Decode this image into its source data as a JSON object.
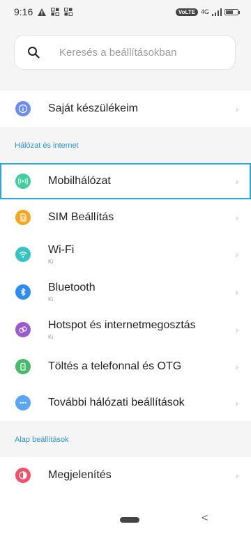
{
  "status_bar": {
    "time": "9:16",
    "left_icons": [
      "alert-icon",
      "sim-data-icon",
      "sim-data-icon"
    ],
    "volte": "VoLTE",
    "network": "4G",
    "battery_level": 0.6
  },
  "search": {
    "placeholder": "Keresés a beállításokban",
    "value": ""
  },
  "top_item": {
    "label": "Saját készülékeim",
    "icon": "info-icon",
    "color": "#6b8cf0"
  },
  "sections": [
    {
      "title": "Hálózat és internet",
      "items": [
        {
          "label": "Mobilhálózat",
          "sub": "",
          "icon": "antenna-icon",
          "color": "#3fcf9a",
          "selected": true
        },
        {
          "label": "SIM Beállítás",
          "sub": "",
          "icon": "sim-card-icon",
          "color": "#f5a623"
        },
        {
          "label": "Wi-Fi",
          "sub": "Ki",
          "icon": "wifi-icon",
          "color": "#37c4c0"
        },
        {
          "label": "Bluetooth",
          "sub": "Ki",
          "icon": "bluetooth-icon",
          "color": "#2d8cf0"
        },
        {
          "label": "Hotspot és internetmegosztás",
          "sub": "Ki",
          "icon": "hotspot-icon",
          "color": "#9b59d0"
        },
        {
          "label": "Töltés a telefonnal és OTG",
          "sub": "",
          "icon": "charging-icon",
          "color": "#46b96b"
        },
        {
          "label": "További hálózati beállítások",
          "sub": "",
          "icon": "more-icon",
          "color": "#5aa5f5"
        }
      ]
    },
    {
      "title": "Alap beállítások",
      "items": [
        {
          "label": "Megjelenítés",
          "sub": "",
          "icon": "display-icon",
          "color": "#f2506a"
        }
      ]
    }
  ],
  "nav": {
    "back_glyph": "<"
  }
}
